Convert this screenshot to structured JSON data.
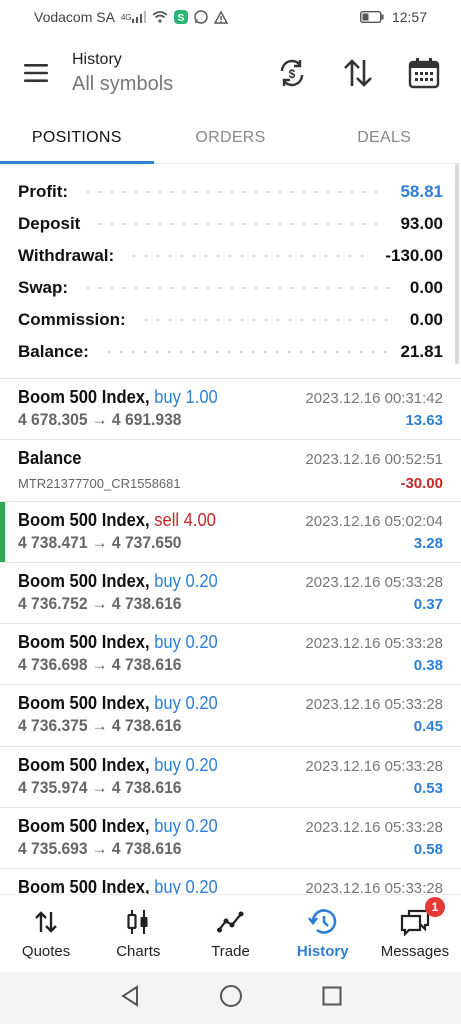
{
  "status_bar": {
    "carrier": "Vodacom SA",
    "network": "4G",
    "time": "12:57"
  },
  "app_bar": {
    "title": "History",
    "subtitle": "All symbols"
  },
  "tabs": [
    {
      "label": "POSITIONS",
      "active": true
    },
    {
      "label": "ORDERS",
      "active": false
    },
    {
      "label": "DEALS",
      "active": false
    }
  ],
  "summary": {
    "profit": {
      "label": "Profit:",
      "value": "58.81"
    },
    "deposit": {
      "label": "Deposit",
      "value": "93.00"
    },
    "withdrawal": {
      "label": "Withdrawal:",
      "value": "-130.00"
    },
    "swap": {
      "label": "Swap:",
      "value": "0.00"
    },
    "commission": {
      "label": "Commission:",
      "value": "0.00"
    },
    "balance": {
      "label": "Balance:",
      "value": "21.81"
    }
  },
  "deals": [
    {
      "symbol": "Boom 500 Index,",
      "side": "buy 1.00",
      "time": "2023.12.16 00:31:42",
      "prices": "4 678.305 → 4 691.938",
      "pnl": "13.63"
    },
    {
      "symbol": "Balance",
      "time": "2023.12.16 00:52:51",
      "comment": "MTR21377700_CR1558681",
      "pnl": "-30.00"
    },
    {
      "symbol": "Boom 500 Index,",
      "side": "sell 4.00",
      "time": "2023.12.16 05:02:04",
      "prices": "4 738.471 → 4 737.650",
      "pnl": "3.28"
    },
    {
      "symbol": "Boom 500 Index,",
      "side": "buy 0.20",
      "time": "2023.12.16 05:33:28",
      "prices": "4 736.752 → 4 738.616",
      "pnl": "0.37"
    },
    {
      "symbol": "Boom 500 Index,",
      "side": "buy 0.20",
      "time": "2023.12.16 05:33:28",
      "prices": "4 736.698 → 4 738.616",
      "pnl": "0.38"
    },
    {
      "symbol": "Boom 500 Index,",
      "side": "buy 0.20",
      "time": "2023.12.16 05:33:28",
      "prices": "4 736.375 → 4 738.616",
      "pnl": "0.45"
    },
    {
      "symbol": "Boom 500 Index,",
      "side": "buy 0.20",
      "time": "2023.12.16 05:33:28",
      "prices": "4 735.974 → 4 738.616",
      "pnl": "0.53"
    },
    {
      "symbol": "Boom 500 Index,",
      "side": "buy 0.20",
      "time": "2023.12.16 05:33:28",
      "prices": "4 735.693 → 4 738.616",
      "pnl": "0.58"
    },
    {
      "symbol": "Boom 500 Index,",
      "side": "buy 0.20",
      "time": "2023.12.16 05:33:28",
      "prices": "",
      "pnl": ""
    }
  ],
  "bottom_nav": [
    {
      "label": "Quotes",
      "icon": "quotes-arrows-icon",
      "active": false
    },
    {
      "label": "Charts",
      "icon": "candlestick-icon",
      "active": false
    },
    {
      "label": "Trade",
      "icon": "trend-line-icon",
      "active": false
    },
    {
      "label": "History",
      "icon": "history-clock-icon",
      "active": true
    },
    {
      "label": "Messages",
      "icon": "messages-icon",
      "active": false,
      "badge": "1"
    }
  ],
  "colors": {
    "accent": "#2d7fd6",
    "negative": "#c62828",
    "highlight": "#34a853"
  }
}
